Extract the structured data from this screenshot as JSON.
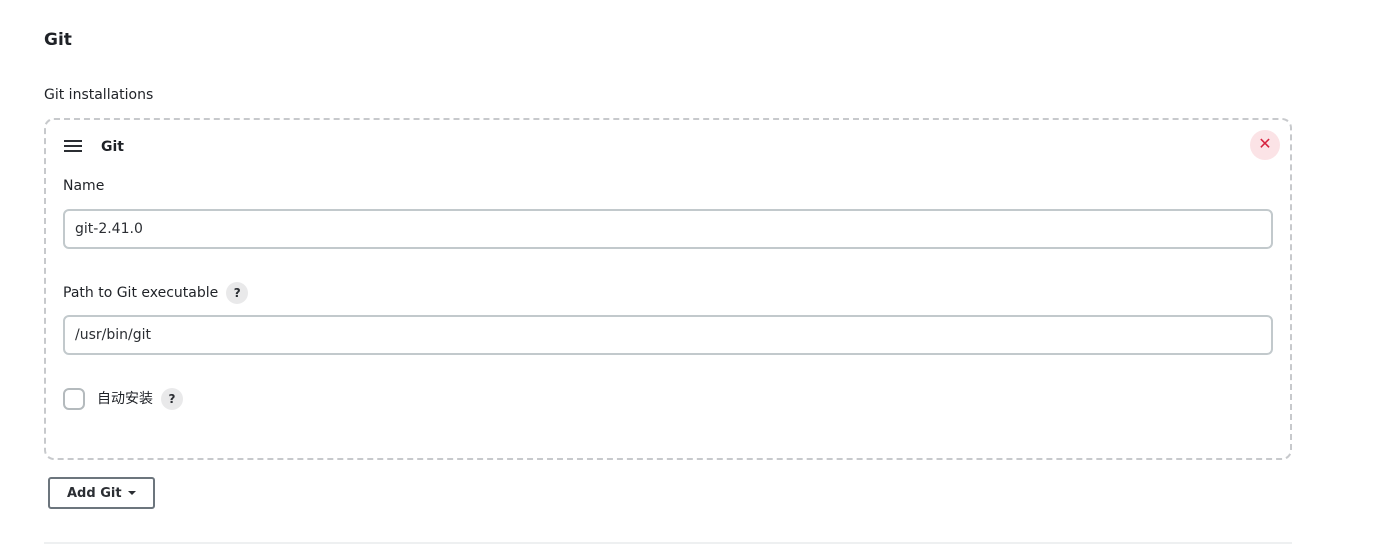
{
  "section": {
    "title": "Git",
    "installations_label": "Git installations"
  },
  "installation": {
    "title": "Git",
    "delete_icon": "close-icon",
    "name_label": "Name",
    "name_value": "git-2.41.0",
    "path_label": "Path to Git executable",
    "path_value": "/usr/bin/git",
    "auto_install_label": "自动安装",
    "auto_install_checked": false,
    "help_glyph": "?"
  },
  "actions": {
    "add_label": "Add Git"
  },
  "colors": {
    "delete_accent": "#d6233f",
    "delete_background": "#fbe3e6",
    "card_border": "#c7c9cc",
    "input_border": "#c2c9cc"
  }
}
